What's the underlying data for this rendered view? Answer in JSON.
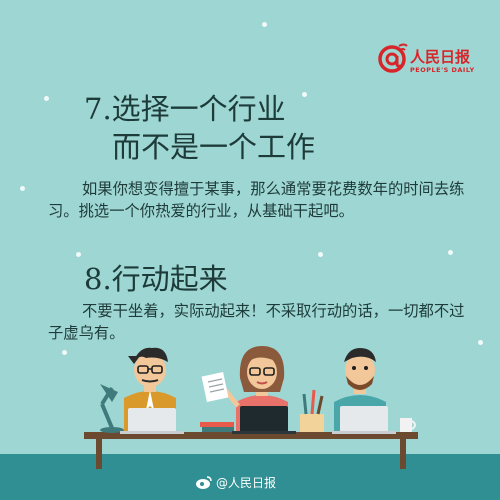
{
  "logo": {
    "name": "人民日报",
    "subtitle": "PEOPLE'S DAILY"
  },
  "tip7": {
    "title_line1": "7.选择一个行业",
    "title_line2": "而不是一个工作",
    "body": "如果你想变得擅于某事，那么通常要花费数年的时间去练习。挑选一个你热爱的行业，从基础干起吧。"
  },
  "tip8": {
    "title": "8.行动起来",
    "body": "不要干坐着，实际动起来！不采取行动的话，一切都不过子虚乌有。"
  },
  "watermark": {
    "text": "@人民日报"
  },
  "colors": {
    "background": "#9ed6d3",
    "floor": "#2f8f92",
    "brand": "#d7252a",
    "text": "#1d3b39"
  }
}
